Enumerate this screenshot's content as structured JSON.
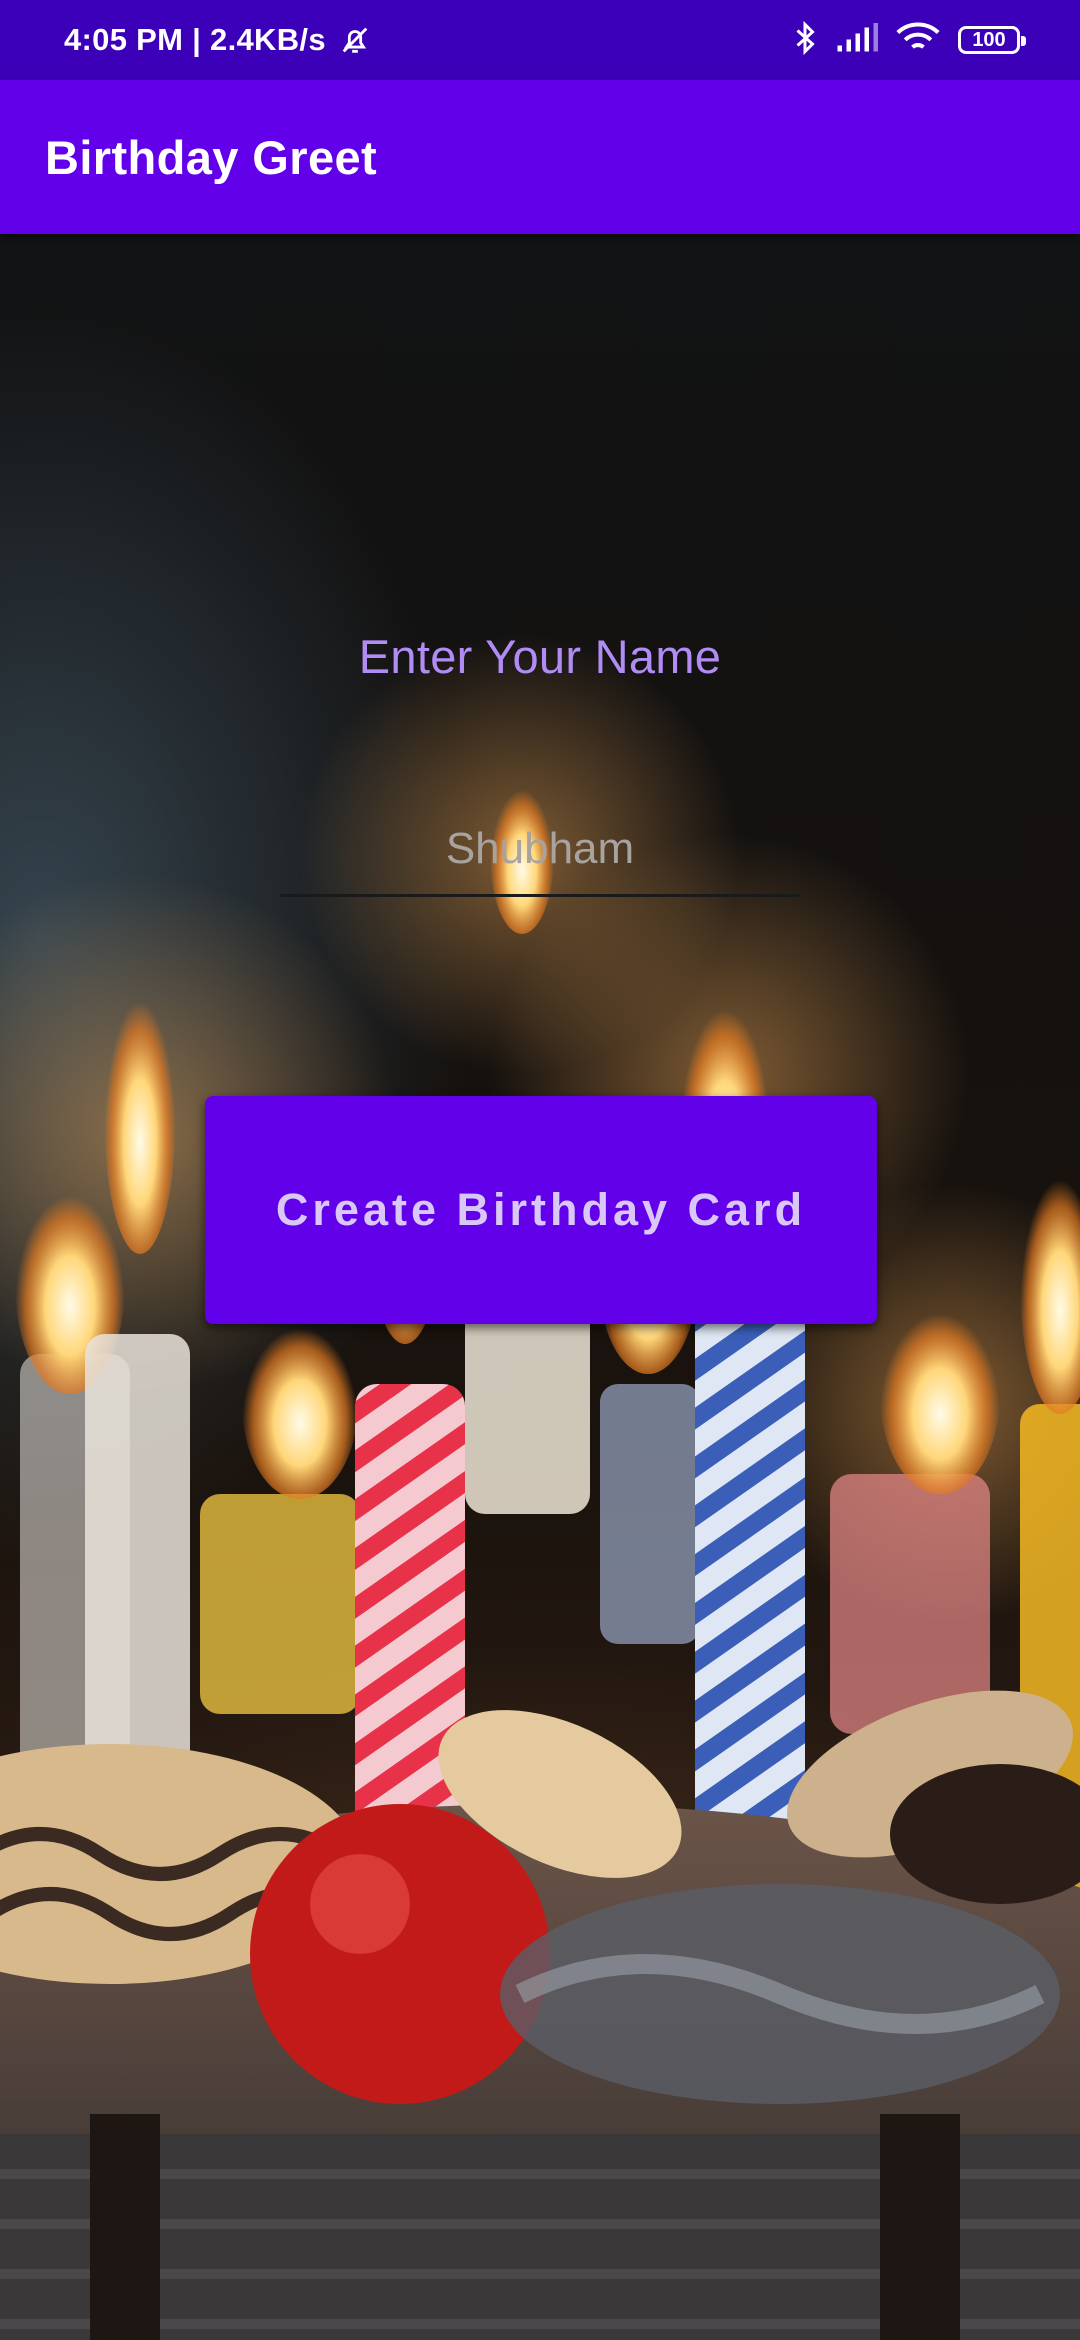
{
  "status_bar": {
    "time_speed": "4:05 PM | 2.4KB/s",
    "battery_level": "100",
    "icons": [
      "bell-off-icon",
      "bluetooth-icon",
      "signal-icon",
      "wifi-icon",
      "battery-icon"
    ]
  },
  "app_bar": {
    "title": "Birthday Greet",
    "color": "#6200ea"
  },
  "form": {
    "prompt": "Enter Your Name",
    "name_value": "Shubham",
    "button_label": "Create Birthday Card"
  },
  "colors": {
    "accent": "#6200ea",
    "status_bar": "#3c00b8",
    "prompt_text": "#b18cf4"
  }
}
